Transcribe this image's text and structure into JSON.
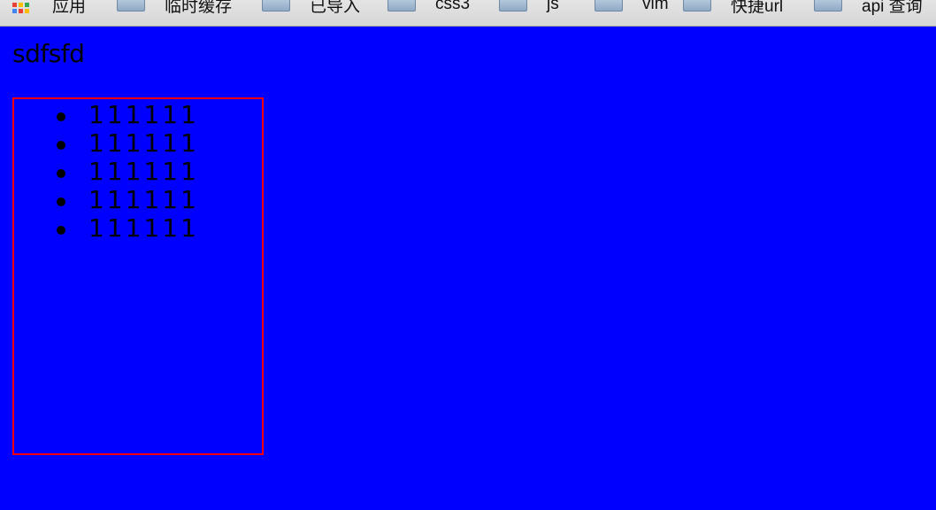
{
  "bookmarks": [
    {
      "icon": "apps-grid-icon",
      "label": "应用"
    },
    {
      "icon": "folder-icon",
      "label": "临时缓存"
    },
    {
      "icon": "folder-icon",
      "label": "已导入"
    },
    {
      "icon": "folder-icon",
      "label": "css3"
    },
    {
      "icon": "folder-icon",
      "label": "js"
    },
    {
      "icon": "folder-icon",
      "label": "vim"
    },
    {
      "icon": "folder-icon",
      "label": "快捷url"
    },
    {
      "icon": "folder-icon",
      "label": "api 查询"
    }
  ],
  "page": {
    "heading": "sdfsfd",
    "items": [
      "111111",
      "111111",
      "111111",
      "111111",
      "111111"
    ],
    "colors": {
      "background": "#0000ff",
      "box_border": "#ff0000",
      "text": "#000000"
    }
  }
}
